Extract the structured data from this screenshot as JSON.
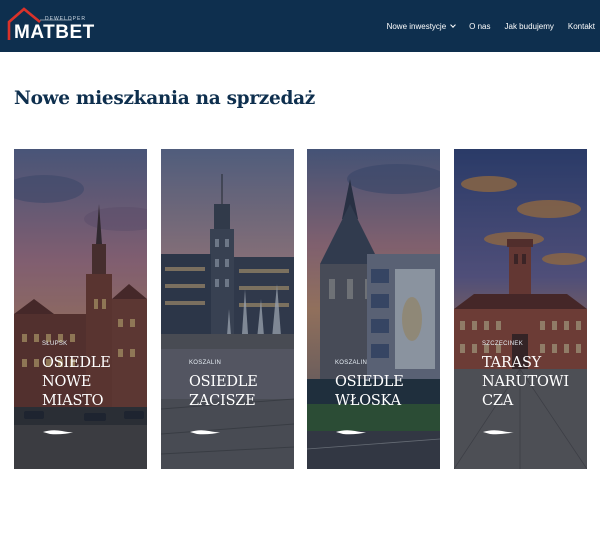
{
  "header": {
    "logo_small": "DEWELOPER",
    "logo_big": "MATBET",
    "nav": [
      {
        "label": "Nowe inwestycje",
        "has_dropdown": true
      },
      {
        "label": "O nas"
      },
      {
        "label": "Jak budujemy"
      },
      {
        "label": "Kontakt"
      }
    ]
  },
  "main": {
    "title": "Nowe mieszkania na sprzedaż",
    "cards": [
      {
        "city": "SŁUPSK",
        "name_lines": [
          "OSIEDLE",
          "NOWE",
          "MIASTO"
        ]
      },
      {
        "city": "KOSZALIN",
        "name_lines": [
          "OSIEDLE",
          "ZACISZE"
        ]
      },
      {
        "city": "KOSZALIN",
        "name_lines": [
          "OSIEDLE",
          "WŁOSKA"
        ]
      },
      {
        "city": "SZCZECINEK",
        "name_lines": [
          "TARASY",
          "NARUTOWI",
          "CZA"
        ]
      }
    ]
  },
  "colors": {
    "header_bg": "#0e2f4e",
    "title": "#0e2f4e",
    "logo_roof": "#d9322a"
  },
  "icons": {
    "logo_roof": "house-roof-icon",
    "nav_dropdown": "chevron-down-icon",
    "card_decoration": "brush-stroke-icon"
  }
}
